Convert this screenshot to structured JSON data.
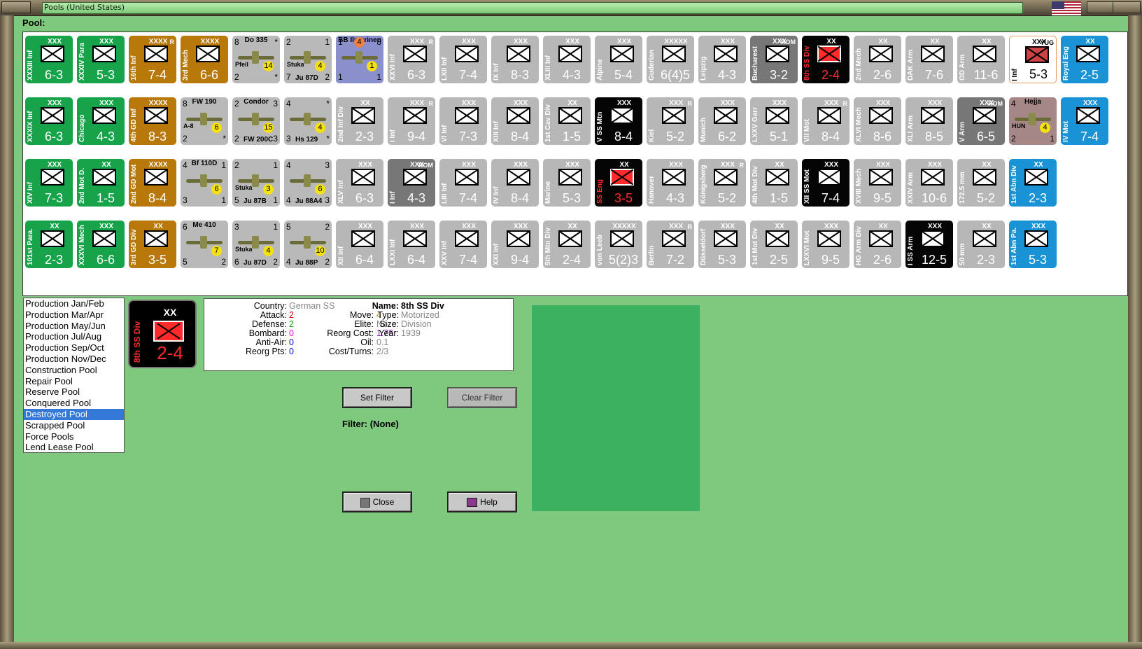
{
  "window": {
    "title": "Pools (United States)"
  },
  "pool_label": "Pool:",
  "counters": [
    [
      {
        "type": "unit",
        "style": "green",
        "name": "XXXIII Inf",
        "size": "XXX",
        "values": "6-3"
      },
      {
        "type": "unit",
        "style": "green",
        "name": "XXXIV Para",
        "size": "XXX",
        "values": "5-3"
      },
      {
        "type": "unit",
        "style": "brown",
        "name": "16th Inf",
        "size": "XXXX",
        "values": "7-4",
        "corner": "R"
      },
      {
        "type": "unit",
        "style": "brown",
        "name": "3rd Mech",
        "size": "XXXX",
        "values": "6-6"
      },
      {
        "type": "air",
        "style": "air",
        "name": "Do 335",
        "sub": "Pfeil",
        "tl": "8",
        "tr": "*",
        "bl": "2",
        "br": "*",
        "dot": "14"
      },
      {
        "type": "air",
        "style": "air",
        "name": "",
        "sub": "Stuka",
        "tl": "2",
        "tr": "1",
        "bl": "7",
        "br": "2",
        "model": "Ju 87D",
        "dot": "4"
      },
      {
        "type": "ship",
        "style": "purple",
        "name": "BB Ilmarinen",
        "tl": "1",
        "tr": "8",
        "top_dot": "4",
        "bl": "1",
        "br": "1",
        "dot": "1"
      },
      {
        "type": "unit",
        "style": "gray",
        "name": "XXVI Inf",
        "size": "XXX",
        "values": "6-3",
        "corner": "R"
      },
      {
        "type": "unit",
        "style": "gray",
        "name": "LXII Inf",
        "size": "XXX",
        "values": "7-4"
      },
      {
        "type": "unit",
        "style": "gray",
        "name": "IX Inf",
        "size": "XXX",
        "values": "8-3"
      },
      {
        "type": "unit",
        "style": "gray",
        "name": "XLIII Inf",
        "size": "XXX",
        "values": "4-3"
      },
      {
        "type": "unit",
        "style": "gray",
        "name": "Alpine",
        "size": "XXX",
        "values": "5-4"
      },
      {
        "type": "unit",
        "style": "gray",
        "name": "Guderian",
        "size": "XXXXX",
        "values": "6(4)5"
      },
      {
        "type": "unit",
        "style": "gray",
        "name": "Leipzig",
        "size": "XXX",
        "values": "4-3"
      },
      {
        "type": "unit",
        "style": "dgray",
        "name": "Bucharest",
        "size": "XXX",
        "values": "3-2",
        "corner": "ROM"
      },
      {
        "type": "unit",
        "style": "black",
        "name": "8th SS Div",
        "size": "XX",
        "values": "2-4",
        "red": true
      },
      {
        "type": "unit",
        "style": "gray",
        "name": "2nd Mech",
        "size": "XX",
        "values": "2-6"
      },
      {
        "type": "unit",
        "style": "gray",
        "name": "DAK Arm",
        "size": "XX",
        "values": "7-6"
      },
      {
        "type": "unit",
        "style": "gray",
        "name": "GD Arm",
        "size": "XX",
        "values": "11-6"
      },
      {
        "type": "unit",
        "style": "white",
        "name": "I Inf",
        "size": "XXX",
        "values": "5-3",
        "corner": "YUG"
      },
      {
        "type": "unit",
        "style": "blue",
        "name": "Royal Eng",
        "size": "XX",
        "values": "2-5"
      }
    ],
    [
      {
        "type": "unit",
        "style": "green",
        "name": "XXXIX Inf",
        "size": "XXX",
        "values": "6-3"
      },
      {
        "type": "unit",
        "style": "green",
        "name": "Chicago",
        "size": "XXX",
        "values": "4-3"
      },
      {
        "type": "unit",
        "style": "brown",
        "name": "4th GD Inf",
        "size": "XXXX",
        "values": "8-3"
      },
      {
        "type": "air",
        "style": "air",
        "name": "FW 190",
        "sub": "A-8",
        "tl": "8",
        "tr": "",
        "bl": "2",
        "br": "*",
        "dot": "6"
      },
      {
        "type": "air",
        "style": "air",
        "name": "Condor",
        "sub": "",
        "tl": "2",
        "tr": "3",
        "bl": "2",
        "br": "3",
        "model": "FW 200C",
        "dot": "15"
      },
      {
        "type": "air",
        "style": "air",
        "name": "",
        "sub": "",
        "tl": "4",
        "tr": "*",
        "bl": "3",
        "br": "*",
        "model": "Hs 129",
        "dot": "4"
      },
      {
        "type": "unit",
        "style": "gray",
        "name": "2nd Inf Div",
        "size": "XX",
        "values": "2-3"
      },
      {
        "type": "unit",
        "style": "gray",
        "name": "I Inf",
        "size": "XXX",
        "values": "9-4",
        "corner": "R"
      },
      {
        "type": "unit",
        "style": "gray",
        "name": "VI Inf",
        "size": "XXX",
        "values": "7-3"
      },
      {
        "type": "unit",
        "style": "gray",
        "name": "XIII Inf",
        "size": "XXX",
        "values": "8-4"
      },
      {
        "type": "unit",
        "style": "gray",
        "name": "1st Cav Div",
        "size": "XX",
        "values": "1-5"
      },
      {
        "type": "unit",
        "style": "black",
        "name": "V SS Mtn",
        "size": "XXX",
        "values": "8-4"
      },
      {
        "type": "unit",
        "style": "gray",
        "name": "Kiel",
        "size": "XXX",
        "values": "5-2",
        "corner": "R"
      },
      {
        "type": "unit",
        "style": "gray",
        "name": "Munich",
        "size": "XXX",
        "values": "6-2"
      },
      {
        "type": "unit",
        "style": "gray",
        "name": "LXXV Garr",
        "size": "XXX",
        "values": "5-1"
      },
      {
        "type": "unit",
        "style": "gray",
        "name": "VII Mot",
        "size": "XXX",
        "values": "8-4",
        "corner": "R"
      },
      {
        "type": "unit",
        "style": "gray",
        "name": "XLVI Mech",
        "size": "XXX",
        "values": "8-6"
      },
      {
        "type": "unit",
        "style": "gray",
        "name": "XLI Arm",
        "size": "XXX",
        "values": "8-5"
      },
      {
        "type": "unit",
        "style": "dgray",
        "name": "V Arm",
        "size": "XXX",
        "values": "6-5",
        "corner": "ROM"
      },
      {
        "type": "air",
        "style": "rose",
        "name": "Hejja",
        "sub": "HUN",
        "tl": "4",
        "tr": "",
        "bl": "2",
        "br": "1",
        "dot": "4"
      },
      {
        "type": "unit",
        "style": "blue",
        "name": "IV Mot",
        "size": "XXX",
        "values": "7-4"
      }
    ],
    [
      {
        "type": "unit",
        "style": "green",
        "name": "XIV Inf",
        "size": "XXX",
        "values": "7-3"
      },
      {
        "type": "unit",
        "style": "green",
        "name": "2nd Mot D.",
        "size": "XX",
        "values": "1-5"
      },
      {
        "type": "unit",
        "style": "brown",
        "name": "2nd GD Mot",
        "size": "XXXX",
        "values": "8-4"
      },
      {
        "type": "air",
        "style": "air",
        "name": "Bf 110D",
        "sub": "",
        "tl": "4",
        "tr": "1",
        "bl": "3",
        "br": "1",
        "dot": "6"
      },
      {
        "type": "air",
        "style": "air",
        "name": "",
        "sub": "Stuka",
        "tl": "2",
        "tr": "1",
        "bl": "5",
        "br": "1",
        "model": "Ju 87B",
        "dot": "3"
      },
      {
        "type": "air",
        "style": "air",
        "name": "",
        "sub": "",
        "tl": "4",
        "tr": "3",
        "bl": "4",
        "br": "3",
        "model": "Ju 88A4",
        "dot": "6"
      },
      {
        "type": "unit",
        "style": "gray",
        "name": "XLV Inf",
        "size": "XXX",
        "values": "6-3"
      },
      {
        "type": "unit",
        "style": "dgray",
        "name": "I Inf",
        "size": "XXX",
        "values": "4-3",
        "corner": "ROM"
      },
      {
        "type": "unit",
        "style": "gray",
        "name": "LIII Inf",
        "size": "XXX",
        "values": "7-4"
      },
      {
        "type": "unit",
        "style": "gray",
        "name": "IV Inf",
        "size": "XXX",
        "values": "8-4"
      },
      {
        "type": "unit",
        "style": "gray",
        "name": "Marine",
        "size": "XXX",
        "values": "5-3"
      },
      {
        "type": "unit",
        "style": "black",
        "name": "SS Eng",
        "size": "XX",
        "values": "3-5",
        "red": true
      },
      {
        "type": "unit",
        "style": "gray",
        "name": "Hanover",
        "size": "XXX",
        "values": "4-3"
      },
      {
        "type": "unit",
        "style": "gray",
        "name": "Königsberg",
        "size": "XXX",
        "values": "5-2",
        "corner": "R"
      },
      {
        "type": "unit",
        "style": "gray",
        "name": "4th Mot Div",
        "size": "XX",
        "values": "1-5"
      },
      {
        "type": "unit",
        "style": "black",
        "name": "XII SS Mot",
        "size": "XXX",
        "values": "7-4"
      },
      {
        "type": "unit",
        "style": "gray",
        "name": "XVIII Mech",
        "size": "XXX",
        "values": "9-5"
      },
      {
        "type": "unit",
        "style": "gray",
        "name": "XXIV Arm",
        "size": "XXX",
        "values": "10-6"
      },
      {
        "type": "unit",
        "style": "gray",
        "name": "172.5 mm",
        "size": "XX",
        "values": "5-2"
      },
      {
        "type": "unit",
        "style": "blue",
        "name": "1st Abn Div",
        "size": "XX",
        "values": "2-3"
      }
    ],
    [
      {
        "type": "unit",
        "style": "green",
        "name": "101st Para.",
        "size": "XX",
        "values": "2-3"
      },
      {
        "type": "unit",
        "style": "green",
        "name": "XXXVI Mech",
        "size": "XXX",
        "values": "6-6"
      },
      {
        "type": "unit",
        "style": "brown",
        "name": "3rd GD Div",
        "size": "XX",
        "values": "3-5"
      },
      {
        "type": "air",
        "style": "air",
        "name": "Me 410",
        "sub": "",
        "tl": "6",
        "tr": "",
        "bl": "5",
        "br": "2",
        "dot": "7"
      },
      {
        "type": "air",
        "style": "air",
        "name": "",
        "sub": "Stuka",
        "tl": "3",
        "tr": "1",
        "bl": "6",
        "br": "2",
        "model": "Ju 87D",
        "dot": "4"
      },
      {
        "type": "air",
        "style": "air",
        "name": "",
        "sub": "",
        "tl": "5",
        "tr": "2",
        "bl": "4",
        "br": "2",
        "model": "Ju 88P",
        "dot": "10"
      },
      {
        "type": "unit",
        "style": "gray",
        "name": "XII Inf",
        "size": "XXX",
        "values": "6-4"
      },
      {
        "type": "unit",
        "style": "gray",
        "name": "LXXI Inf",
        "size": "XXX",
        "values": "6-4"
      },
      {
        "type": "unit",
        "style": "gray",
        "name": "XXV Inf",
        "size": "XXX",
        "values": "7-4"
      },
      {
        "type": "unit",
        "style": "gray",
        "name": "XXI Inf",
        "size": "XXX",
        "values": "9-4"
      },
      {
        "type": "unit",
        "style": "gray",
        "name": "5th Mtn Div",
        "size": "XX",
        "values": "2-4"
      },
      {
        "type": "unit",
        "style": "gray",
        "name": "von Leeb",
        "size": "XXXXX",
        "values": "5(2)3"
      },
      {
        "type": "unit",
        "style": "gray",
        "name": "Berlin",
        "size": "XXX",
        "values": "7-2",
        "corner": "R"
      },
      {
        "type": "unit",
        "style": "gray",
        "name": "Düsseldorf",
        "size": "XXX",
        "values": "5-3"
      },
      {
        "type": "unit",
        "style": "gray",
        "name": "1st Mot Div",
        "size": "XX",
        "values": "2-5"
      },
      {
        "type": "unit",
        "style": "gray",
        "name": "LXXVI Mot",
        "size": "XXX",
        "values": "9-5"
      },
      {
        "type": "unit",
        "style": "gray",
        "name": "HG Arm Div",
        "size": "XX",
        "values": "2-6"
      },
      {
        "type": "unit",
        "style": "black",
        "name": "I SS Arm",
        "size": "XXX",
        "values": "12-5"
      },
      {
        "type": "unit",
        "style": "gray",
        "name": "50 mm",
        "size": "XX",
        "values": "2-3"
      },
      {
        "type": "unit",
        "style": "blue",
        "name": "1st Abn Pa.",
        "size": "XXX",
        "values": "5-3"
      }
    ]
  ],
  "pool_list": {
    "items": [
      "Production Jan/Feb",
      "Production Mar/Apr",
      "Production May/Jun",
      "Production Jul/Aug",
      "Production Sep/Oct",
      "Production Nov/Dec",
      "Construction Pool",
      "Repair Pool",
      "Reserve Pool",
      "Conquered Pool",
      "Destroyed Pool",
      "Scrapped Pool",
      "Force Pools",
      "Lend Lease Pool"
    ],
    "selected_index": 10
  },
  "selected_counter": {
    "name": "8th SS Div",
    "size": "XX",
    "values": "2-4"
  },
  "info": {
    "country_label": "Country:",
    "country": "German SS",
    "attack_label": "Attack:",
    "attack": "2",
    "defense_label": "Defense:",
    "defense": "2",
    "bombard_label": "Bombard:",
    "bombard": "0",
    "antiair_label": "Anti-Air:",
    "antiair": "0",
    "reorgpts_label": "Reorg Pts:",
    "reorgpts": "0",
    "move_label": "Move:",
    "move": "4",
    "elite_label": "Elite:",
    "elite": "No",
    "reorgcost_label": "Reorg Cost:",
    "reorgcost": "1.75",
    "oil_label": "Oil:",
    "oil": "0.1",
    "costturns_label": "Cost/Turns:",
    "costturns": "2/3",
    "name_label": "Name:",
    "name": "8th SS Div",
    "type_label": "Type:",
    "type": "Motorized",
    "size_label": "Size:",
    "size": "Division",
    "year_label": "Year:",
    "year": "1939"
  },
  "buttons": {
    "set_filter": "Set Filter",
    "clear_filter": "Clear Filter",
    "close": "Close",
    "help": "Help"
  },
  "filter_text": "Filter: (None)",
  "colors": {
    "selection": "#3478d8",
    "preview": "#3cb15f"
  }
}
